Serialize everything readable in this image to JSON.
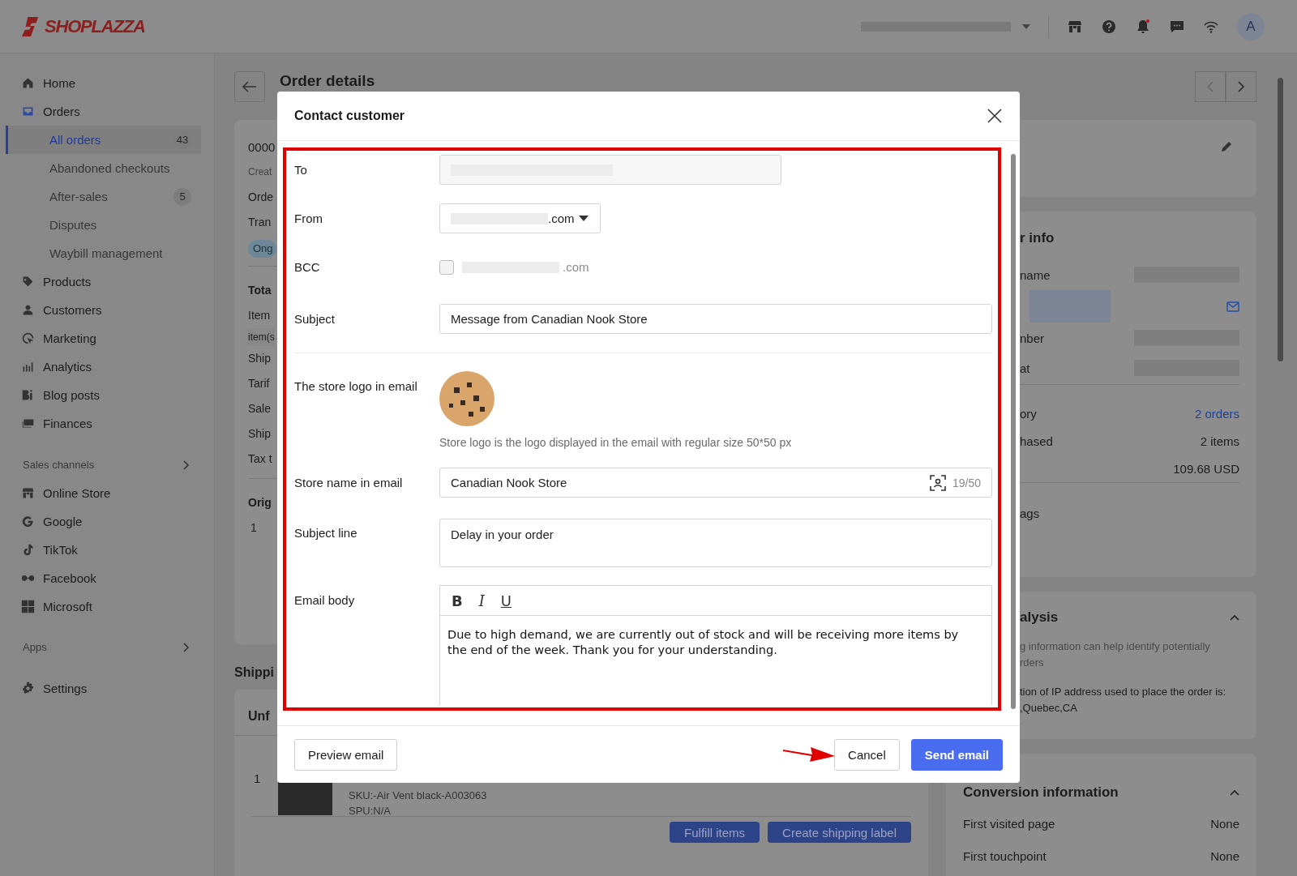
{
  "topbar": {
    "logo": "SHOPLAZZA",
    "avatar": "A",
    "unread": true
  },
  "nav": [
    {
      "label": "Home",
      "selected": false
    },
    {
      "label": "Orders",
      "selected": false,
      "expanded": true,
      "children": [
        {
          "label": "All orders",
          "count": "43",
          "selected": true
        },
        {
          "label": "Abandoned checkouts",
          "selected": false
        },
        {
          "label": "After-sales",
          "count": "5",
          "selected": false
        },
        {
          "label": "Disputes",
          "selected": false
        },
        {
          "label": "Waybill management",
          "selected": false
        }
      ]
    },
    {
      "label": "Products",
      "selected": false
    },
    {
      "label": "Customers",
      "selected": false
    },
    {
      "label": "Marketing",
      "selected": false
    },
    {
      "label": "Analytics",
      "selected": false
    },
    {
      "label": "Blog posts",
      "selected": false
    },
    {
      "label": "Finances",
      "selected": false
    }
  ],
  "sales_channels": {
    "label": "Sales channels",
    "items": [
      {
        "label": "Online Store"
      },
      {
        "label": "Google"
      },
      {
        "label": "TikTok"
      },
      {
        "label": "Facebook"
      },
      {
        "label": "Microsoft"
      }
    ]
  },
  "apps": {
    "label": "Apps"
  },
  "settings": {
    "label": "Settings"
  },
  "page": {
    "title": "Order details"
  },
  "order_card": {
    "groups": [
      [
        {
          "kind": "number",
          "text": "0000"
        },
        {
          "kind": "meta",
          "text": "Creat"
        },
        {
          "kind": "text",
          "text": "Orde"
        },
        {
          "kind": "text",
          "text": "Tran"
        },
        {
          "kind": "badge",
          "text": "Ong"
        }
      ],
      [
        {
          "kind": "heading",
          "text": "Tota"
        },
        {
          "kind": "text",
          "text": "Item"
        },
        {
          "kind": "note",
          "text": "item(s"
        },
        {
          "kind": "text",
          "text": "Ship"
        },
        {
          "kind": "text",
          "text": "Tarif"
        },
        {
          "kind": "text",
          "text": "Sale"
        },
        {
          "kind": "text",
          "text": "Ship"
        },
        {
          "kind": "text",
          "text": "Tax t"
        }
      ],
      [
        {
          "kind": "heading",
          "text": "Orig"
        },
        {
          "kind": "qty",
          "text": "1"
        }
      ]
    ]
  },
  "shipping": {
    "heading": "Shippi",
    "title": "Unf",
    "qty": "1",
    "sku": "SKU:-Air Vent black-A003063",
    "spu": "SPU:N/A",
    "buttons": [
      "Fulfill items",
      "Create shipping label"
    ]
  },
  "customer_card": {
    "title": "r info",
    "rows": [
      {
        "kind": "redacted",
        "label": "name"
      },
      {
        "kind": "email"
      },
      {
        "kind": "redacted",
        "label": "nber"
      },
      {
        "kind": "redacted",
        "label": "at"
      },
      {
        "kind": "link",
        "label": "ory",
        "value": "2 orders"
      },
      {
        "kind": "value",
        "label": "hased",
        "value": "2 items"
      },
      {
        "kind": "value",
        "value": "109.68 USD"
      },
      {
        "kind": "label",
        "label": "ags"
      }
    ]
  },
  "risk_card": {
    "title": "alysis",
    "expanded": true,
    "lines": [
      {
        "kind": "note",
        "text": "g information can help identify potentially"
      },
      {
        "kind": "note",
        "text": "rders"
      },
      {
        "kind": "text",
        "text": "tion of IP address used to place the order is:"
      },
      {
        "kind": "text",
        "text": ",Quebec,CA"
      }
    ]
  },
  "conversion_card": {
    "title": "Conversion information",
    "expanded": true,
    "rows": [
      {
        "label": "First visited page",
        "value": "None"
      },
      {
        "label": "First touchpoint",
        "value": "None"
      }
    ]
  },
  "modal": {
    "title": "Contact customer",
    "fields": [
      {
        "kind": "redacted",
        "label": "To"
      },
      {
        "kind": "select",
        "label": "From",
        "suffix": ".com"
      },
      {
        "kind": "checkbox",
        "label": "BCC",
        "checked": false,
        "suffix": ".com"
      },
      {
        "kind": "input",
        "label": "Subject",
        "value": "Message from Canadian Nook Store"
      },
      {
        "kind": "logo",
        "label": "The store logo in email",
        "hint": "Store logo is the logo displayed in the email with regular size 50*50 px"
      },
      {
        "kind": "counter",
        "label": "Store name in email",
        "value": "Canadian Nook Store",
        "counter": "19/50"
      },
      {
        "kind": "textarea",
        "label": "Subject line",
        "value": "Delay in your order"
      },
      {
        "kind": "editor",
        "label": "Email body",
        "toolbar": [
          "B",
          "I",
          "U"
        ],
        "value": "Due to high demand, we are currently out of stock and will be receiving more items by the end of the week. Thank you for your understanding."
      }
    ],
    "buttons": [
      {
        "label": "Preview email",
        "kind": "secondary"
      },
      {
        "label": "Cancel",
        "kind": "secondary"
      },
      {
        "label": "Send email",
        "kind": "primary"
      }
    ]
  }
}
